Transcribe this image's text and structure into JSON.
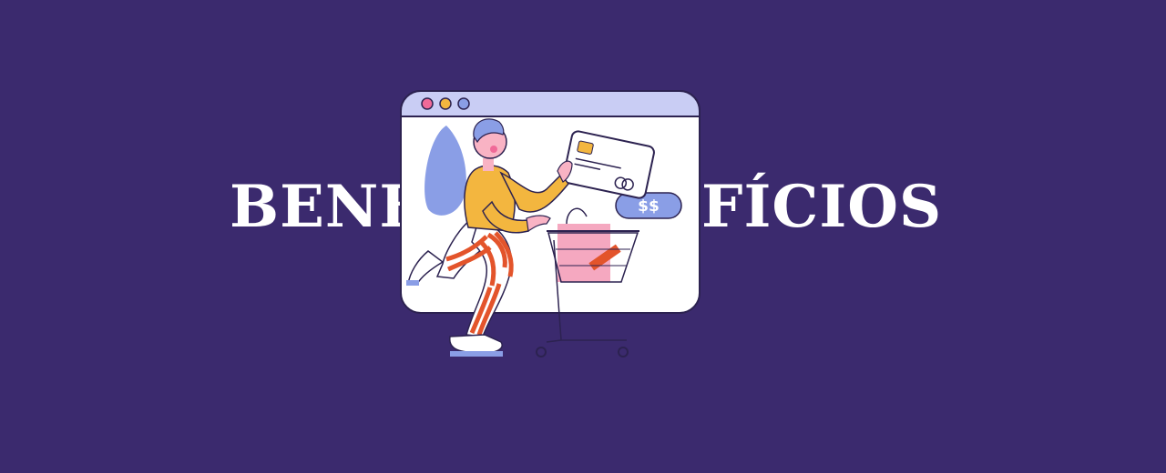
{
  "headline": {
    "left": "BENE",
    "right": "FÍCIOS"
  },
  "illustration": {
    "card_tag": "$$",
    "colors": {
      "background": "#3b2a6e",
      "window_bar": "#c9cdf4",
      "window_body": "#ffffff",
      "hair": "#8a9ee6",
      "sweater": "#f3b63f",
      "stripes": "#e3542b",
      "skin": "#f9b3c4",
      "bag": "#f5a8c0",
      "tag_pill": "#8a9ee6"
    },
    "icons": [
      "browser-window",
      "credit-card-icon",
      "shopping-bag-icon",
      "shopping-cart-icon"
    ]
  }
}
